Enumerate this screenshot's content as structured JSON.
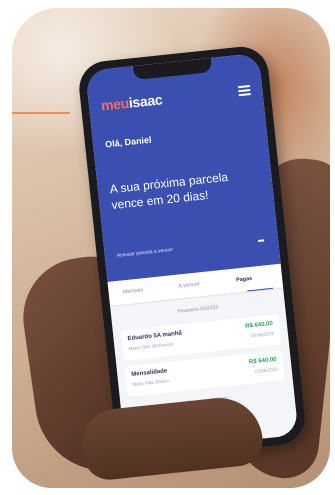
{
  "brand": {
    "part1": "meu",
    "part2": "isaac"
  },
  "greeting": "Olá, Daniel",
  "headline": "A sua próxima parcela vence em 20 dias!",
  "hero_footer": "Acessar parcela a vencer",
  "tabs": [
    {
      "label": "Mensais"
    },
    {
      "label": "A vencer"
    },
    {
      "label": "Pagas"
    }
  ],
  "date_separator": "Fevereiro 03/2023",
  "installments": [
    {
      "title": "Eduardo 5A manhã",
      "subtitle": "Maria Vitta 30/Vencido",
      "amount": "R$ 640,00",
      "date": "07/08/2022"
    },
    {
      "title": "Mensalidade",
      "subtitle": "Maria Vitta 30/ano",
      "amount": "R$ 640,00",
      "date": "07/08/2022"
    }
  ],
  "date_separator_2": "Setembro 08/2022",
  "colors": {
    "hero": "#3a4fb0",
    "brand_accent": "#ff6d5a",
    "amount": "#2f9e5b"
  }
}
